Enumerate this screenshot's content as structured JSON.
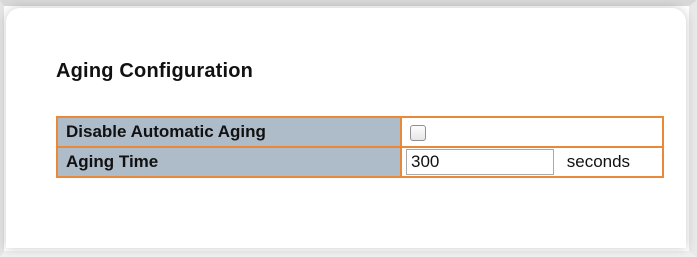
{
  "section": {
    "title": "Aging Configuration"
  },
  "rows": [
    {
      "label": "Disable Automatic Aging",
      "control": "checkbox",
      "checked": false
    },
    {
      "label": "Aging Time",
      "control": "text-input",
      "value": "300",
      "unit": "seconds"
    }
  ],
  "colors": {
    "label_background": "#aebbc9",
    "table_border": "#e8893a"
  }
}
